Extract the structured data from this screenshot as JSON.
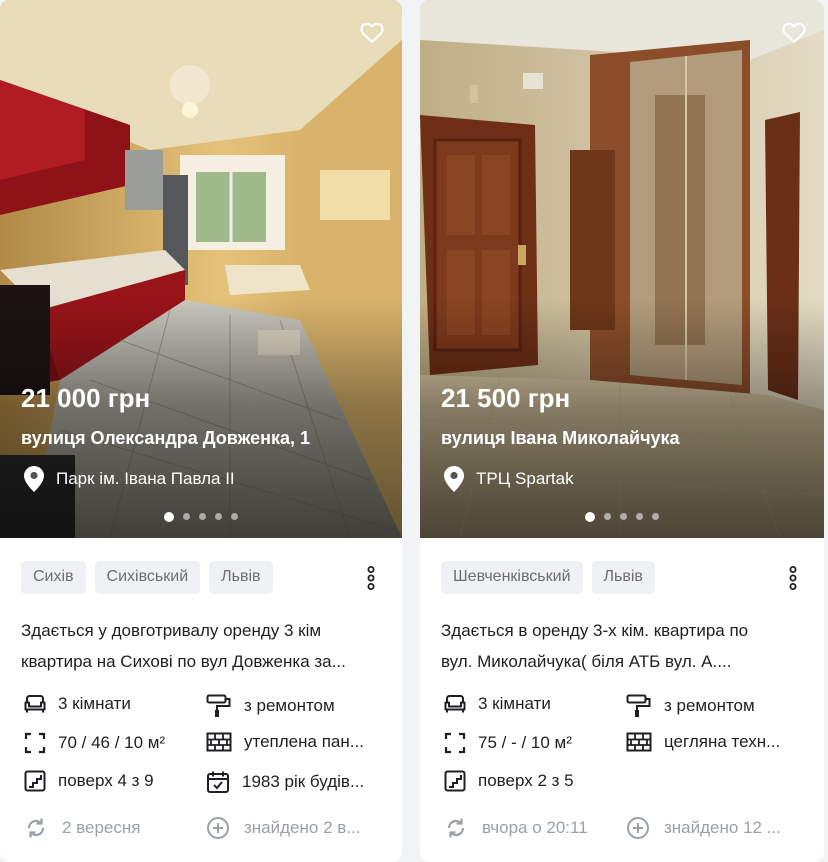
{
  "cards": [
    {
      "price": "21 000 грн",
      "street": "вулиця Олександра Довженка, 1",
      "landmark": "Парк ім. Івана Павла ІІ",
      "tags": [
        "Сихів",
        "Сихівський",
        "Львів"
      ],
      "description_lines": [
        "Здається у довготривалу оренду 3 кім",
        "квартира на Сихові по вул Довженка за..."
      ],
      "features": {
        "rooms": "3 кімнати",
        "condition": "з ремонтом",
        "area": "70 / 46 / 10 м²",
        "wall": "утеплена пан...",
        "floor": "поверх 4 з 9",
        "year": "1983 рік будів..."
      },
      "updated": "2 вересня",
      "found": "знайдено 2 в..."
    },
    {
      "price": "21 500 грн",
      "street": "вулиця Івана Миколайчука",
      "landmark": "ТРЦ Spartak",
      "tags": [
        "Шевченківський",
        "Львів"
      ],
      "description_lines": [
        "Здається в оренду 3-х кім. квартира по",
        "вул. Миколайчука( біля АТБ вул. А...."
      ],
      "features": {
        "rooms": "3 кімнати",
        "condition": "з ремонтом",
        "area": "75 / - / 10 м²",
        "wall": "цегляна техн...",
        "floor": "поверх 2 з 5"
      },
      "updated": "вчора о 20:11",
      "found": "знайдено 12 ..."
    }
  ],
  "icons": {
    "favorite": "heart-outline-icon",
    "location": "map-pin-icon",
    "menu": "kebab-menu-icon",
    "rooms": "sofa-icon",
    "condition": "paint-roller-icon",
    "area": "area-frame-icon",
    "wall": "brick-wall-icon",
    "floor": "stairs-icon",
    "year": "calendar-icon",
    "updated": "refresh-icon",
    "found": "plus-circle-icon"
  },
  "colors": {
    "card_background": "#ffffff",
    "page_background": "#f2f3f5",
    "tag_background": "#f0f1f4",
    "muted_text": "#9aa0a9"
  },
  "carousel": {
    "slides": 5,
    "active_index": 0
  }
}
